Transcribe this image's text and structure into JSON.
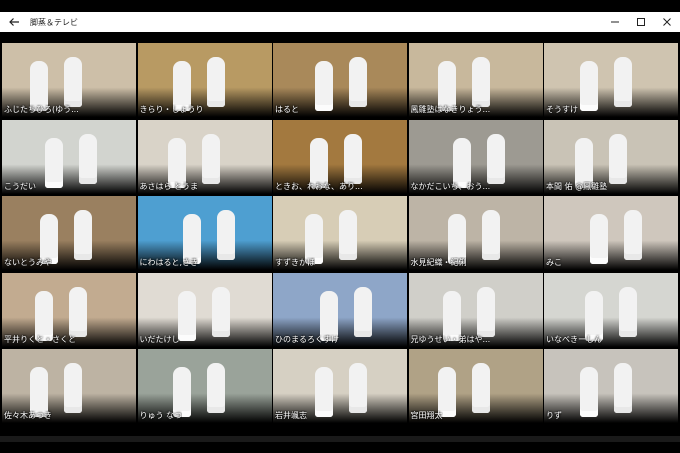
{
  "window": {
    "title": "脚蒸＆テレビ",
    "back_icon": "back-arrow-icon",
    "minimize_icon": "minimize-icon",
    "maximize_icon": "maximize-icon",
    "close_icon": "close-icon"
  },
  "participants": [
    {
      "name": "ふじたちひろ(ゆう...",
      "bg": "#cdbfa8"
    },
    {
      "name": "きらり・しょうり",
      "bg": "#b89a63"
    },
    {
      "name": "はると",
      "bg": "#a9895a"
    },
    {
      "name": "鳳雛塾はなきりょう...",
      "bg": "#c8b89c"
    },
    {
      "name": "そうすけ",
      "bg": "#cfc4b0"
    },
    {
      "name": "こうだい",
      "bg": "#d2d4cf"
    },
    {
      "name": "あさはら とうま",
      "bg": "#d9d3c8"
    },
    {
      "name": "ときお、れおな、あり...",
      "bg": "#a3793f"
    },
    {
      "name": "なかだこいち、おう...",
      "bg": "#9d9a92"
    },
    {
      "name": "本間 佑 @鳳雛塾",
      "bg": "#c9c3b6"
    },
    {
      "name": "ないとうみや",
      "bg": "#9a8060"
    },
    {
      "name": "にわはると,さき",
      "bg": "#4e9fd1"
    },
    {
      "name": "すずきかほ",
      "bg": "#d7cdb6"
    },
    {
      "name": "水見紀織・紀俐",
      "bg": "#bdb4a6"
    },
    {
      "name": "みこ",
      "bg": "#cfc7bd"
    },
    {
      "name": "平井りくと・さくと",
      "bg": "#c2ab90"
    },
    {
      "name": "いだたけし",
      "bg": "#e0dbd3"
    },
    {
      "name": "ひのまるろくすけ",
      "bg": "#8ea6c8"
    },
    {
      "name": "兄ゆうせい・弟はや...",
      "bg": "#d0cfc9"
    },
    {
      "name": "いなべきーしん",
      "bg": "#d5d6d1"
    },
    {
      "name": "佐々木あつき",
      "bg": "#bdb3a3"
    },
    {
      "name": "りゅう なつ",
      "bg": "#9aa39a"
    },
    {
      "name": "岩井颯志",
      "bg": "#d6d0c3"
    },
    {
      "name": "宮田翔太",
      "bg": "#b0a286"
    },
    {
      "name": "りず",
      "bg": "#c7c3bc"
    }
  ]
}
